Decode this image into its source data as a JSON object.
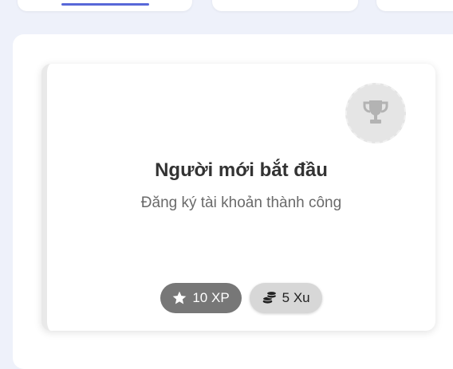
{
  "achievement": {
    "title": "Người mới bắt đầu",
    "description": "Đăng ký tài khoản thành công",
    "icon": "trophy-icon",
    "rewards": {
      "xp_label": "10 XP",
      "xp_icon": "star-icon",
      "coin_label": "5 Xu",
      "coin_icon": "coins-icon"
    }
  },
  "colors": {
    "tab_underline": "#5868d8",
    "xp_badge": "#777777",
    "coin_badge": "#d7d7d7"
  }
}
